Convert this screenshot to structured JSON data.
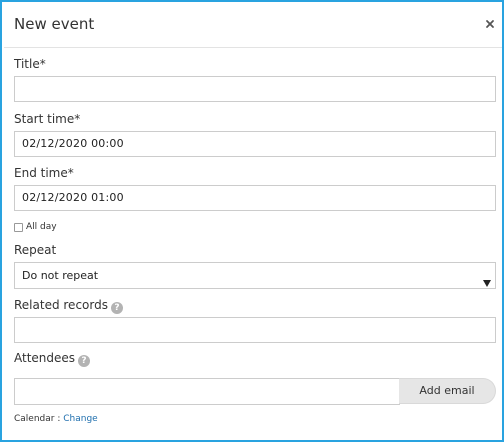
{
  "dialog": {
    "title": "New event",
    "close_label": "×"
  },
  "form": {
    "title_label": "Title*",
    "title_value": "",
    "start_label": "Start time*",
    "start_value": "02/12/2020 00:00",
    "end_label": "End time*",
    "end_value": "02/12/2020 01:00",
    "all_day_label": "All day",
    "all_day_checked": false,
    "repeat_label": "Repeat",
    "repeat_value": "Do not repeat",
    "related_label": "Related records",
    "related_value": "",
    "attendees_label": "Attendees",
    "attendees_value": "",
    "add_email_label": "Add email",
    "help_glyph": "?",
    "calendar_label": "Calendar :",
    "calendar_link": "Change"
  },
  "colors": {
    "accent_border": "#29a3e0",
    "link": "#1f6fae",
    "help_icon": "#b3b3b3"
  },
  "icons": {
    "close": "close-icon",
    "select_arrow": "chevron-down-icon",
    "help": "help-icon"
  }
}
